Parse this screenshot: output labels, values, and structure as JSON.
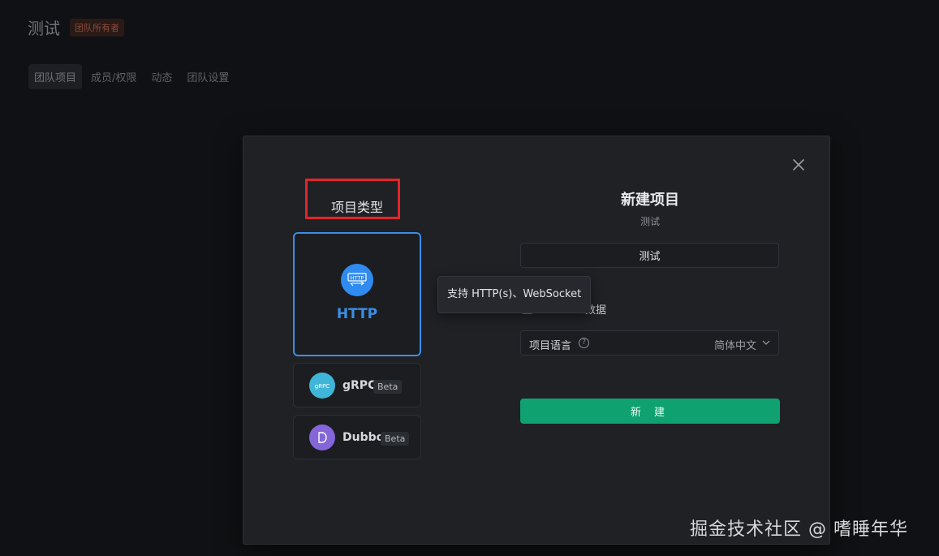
{
  "team": {
    "title": "测试",
    "owner_badge": "团队所有者",
    "tabs": [
      {
        "label": "团队项目",
        "active": true
      },
      {
        "label": "成员/权限",
        "active": false
      },
      {
        "label": "动态",
        "active": false
      },
      {
        "label": "团队设置",
        "active": false
      }
    ]
  },
  "modal": {
    "type_heading": "项目类型",
    "types": [
      {
        "label": "HTTP",
        "icon": "http-icon",
        "selected": true
      },
      {
        "label": "gRPC",
        "badge": "Beta",
        "icon": "grpc-icon"
      },
      {
        "label": "Dubbo",
        "badge": "Beta",
        "icon": "dubbo-icon"
      }
    ],
    "tooltip": "支持 HTTP(s)、WebSocket",
    "form": {
      "title": "新建项目",
      "subtitle": "测试",
      "name_value": "测试",
      "sample_label": "数据",
      "language_label": "项目语言",
      "language_value": "简体中文",
      "create_button": "新 建"
    }
  },
  "watermark": "掘金技术社区 @ 嗜睡年华",
  "colors": {
    "accent_blue": "#3a8ee6",
    "primary_green": "#10a170",
    "highlight_red": "#e0262b"
  }
}
